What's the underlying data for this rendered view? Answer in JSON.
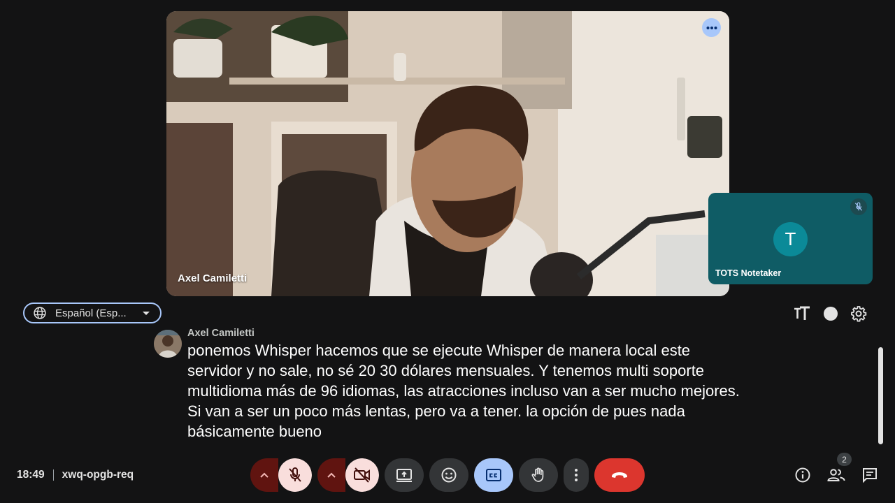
{
  "main_video": {
    "participant_name": "Axel Camiletti",
    "more_icon": "more-horiz-icon"
  },
  "self_tile": {
    "participant_name": "TOTS Notetaker",
    "avatar_initial": "T",
    "mic_state_icon": "mic-off-icon"
  },
  "captions": {
    "language": "Español (Esp...",
    "speaker": "Axel Camiletti",
    "text": "ponemos Whisper hacemos que se ejecute Whisper de manera local este servidor y no sale, no sé 20 30 dólares mensuales. Y tenemos multi soporte multidioma más de 96 idiomas, las atracciones incluso van a ser mucho mejores. Si van a ser un poco más lentas, pero va a tener. la opción de pues nada básicamente bueno"
  },
  "meeting": {
    "time": "18:49",
    "code": "xwq-opgb-req"
  },
  "controls": {
    "mic": "mic-off-icon",
    "camera": "videocam-off-icon",
    "present": "present-screen-icon",
    "reactions": "emoji-icon",
    "captions": "closed-captions-icon",
    "raise_hand": "raise-hand-icon",
    "more": "more-vert-icon",
    "leave": "call-end-icon"
  },
  "people_count": "2",
  "colors": {
    "accent": "#a8c7fa",
    "leave": "#dc362e",
    "muted_bg": "#f9dedc",
    "muted_caret": "#601410",
    "tile_teal": "#0f5c65"
  }
}
